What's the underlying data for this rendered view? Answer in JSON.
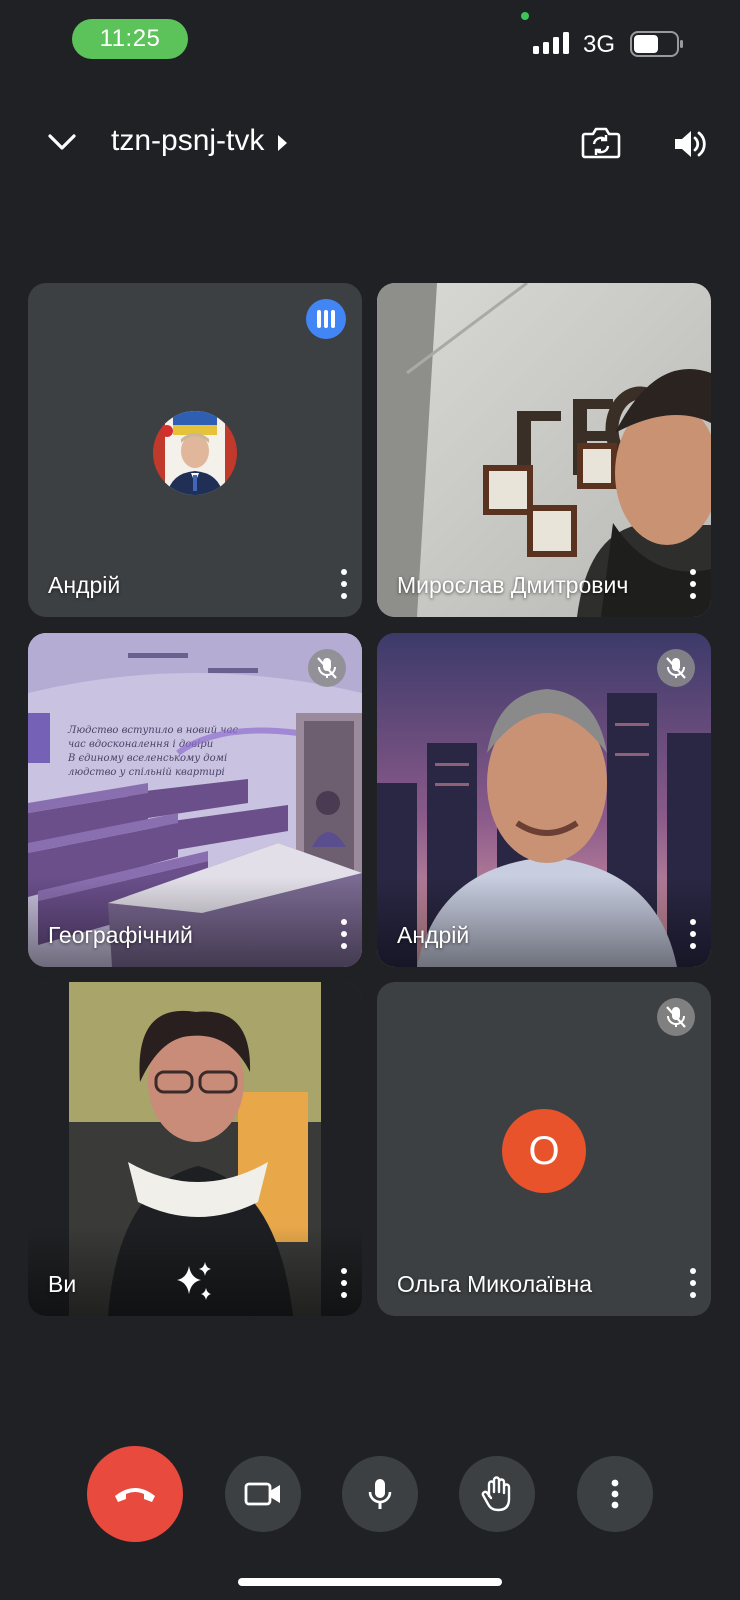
{
  "status_bar": {
    "time": "11:25",
    "network": "3G",
    "signal_icon": "signal-bars-icon",
    "battery_icon": "battery-icon",
    "battery_level": 0.55
  },
  "header": {
    "collapse_icon": "chevron-down-icon",
    "meeting_code": "tzn-psnj-tvk",
    "expand_icon": "caret-right-icon",
    "switch_camera_icon": "switch-camera-icon",
    "audio_output_icon": "speaker-icon"
  },
  "participants": [
    {
      "name": "Андрій",
      "state": "speaking",
      "media": "avatar-photo"
    },
    {
      "name": "Мирослав Дмитрович",
      "state": "video",
      "media": "camera-video"
    },
    {
      "name": "Географічний",
      "state": "muted",
      "media": "camera-video"
    },
    {
      "name": "Андрій",
      "state": "muted",
      "media": "camera-video"
    },
    {
      "name": "Ви",
      "state": "self-video",
      "media": "camera-video",
      "effects_icon": "sparkle-effects-icon"
    },
    {
      "name": "Ольга Миколаївна",
      "state": "muted",
      "media": "avatar-letter",
      "avatar_letter": "О",
      "avatar_color": "#e8532b"
    }
  ],
  "controls": {
    "end_call_icon": "end-call-icon",
    "camera_icon": "video-camera-icon",
    "mic_icon": "microphone-icon",
    "raise_hand_icon": "raise-hand-icon",
    "more_icon": "more-vertical-icon",
    "end_call_color": "#e84a3e"
  },
  "colors": {
    "background": "#202124",
    "tile": "#3c4043",
    "speaking_indicator": "#4285f4",
    "status_time_pill": "#5cc35b"
  }
}
